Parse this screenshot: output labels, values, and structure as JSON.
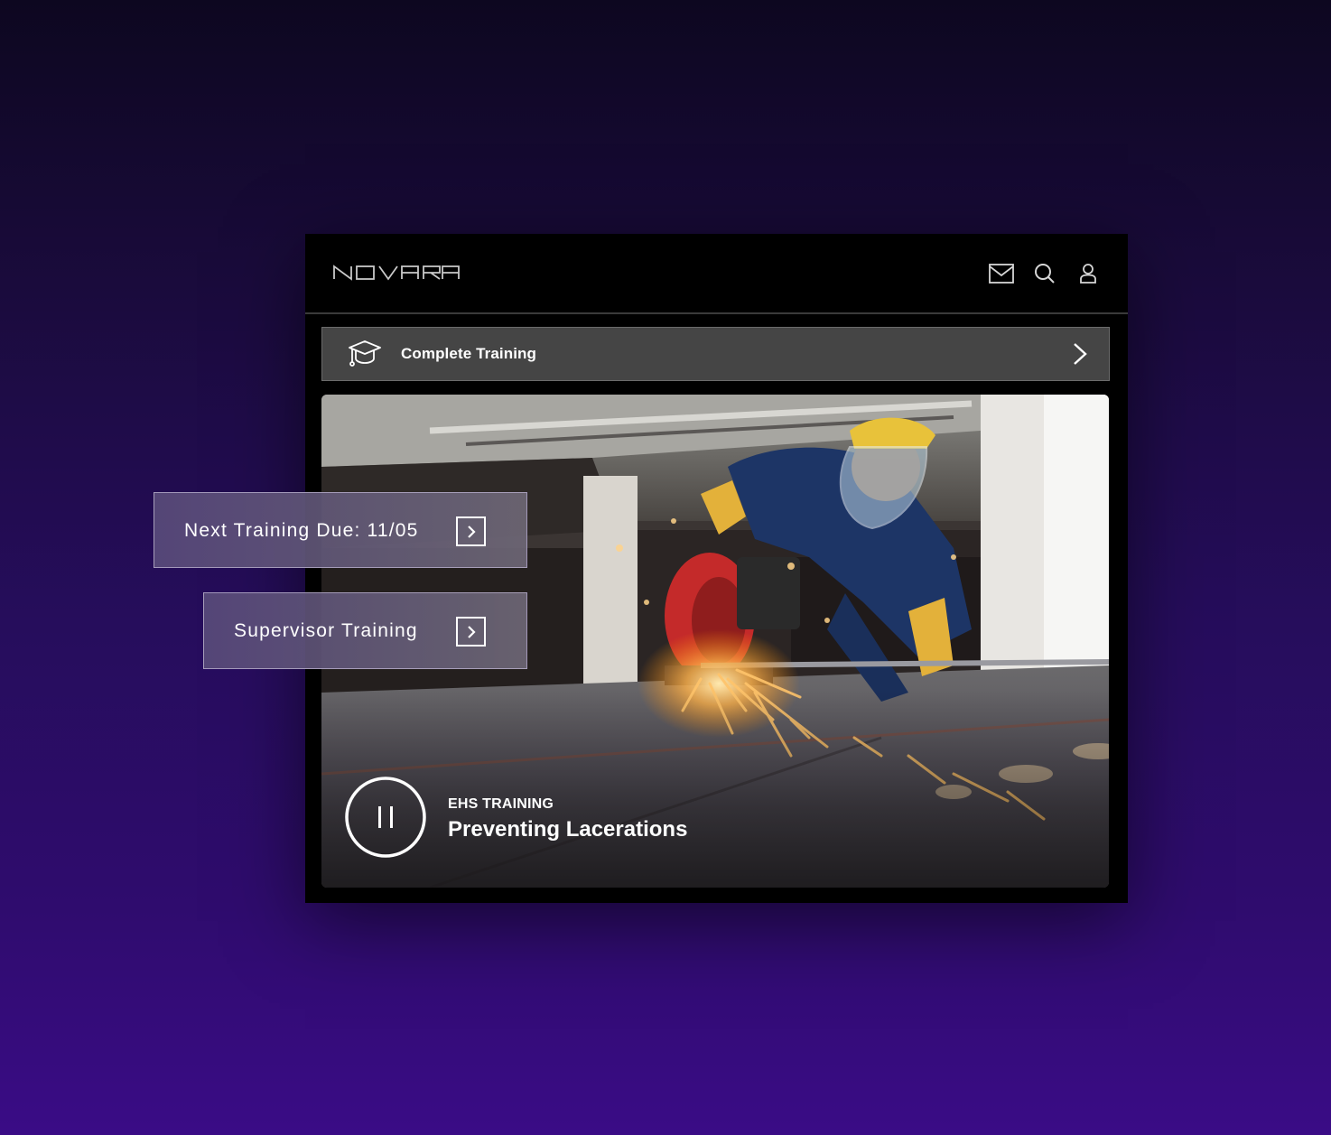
{
  "header": {
    "logo_text": "NOVARA",
    "icons": [
      "mail-icon",
      "search-icon",
      "user-icon"
    ]
  },
  "complete_training": {
    "label": "Complete Training",
    "icon": "graduation-cap-icon"
  },
  "video": {
    "kicker": "EHS TRAINING",
    "title": "Preventing Lacerations",
    "control": "pause-icon"
  },
  "cards": {
    "next_training": "Next Training Due: 11/05",
    "supervisor_training": "Supervisor Training"
  },
  "colors": {
    "background_top": "#0d0720",
    "background_bottom": "#3a0c86",
    "window": "#000000",
    "bar": "#454545"
  }
}
